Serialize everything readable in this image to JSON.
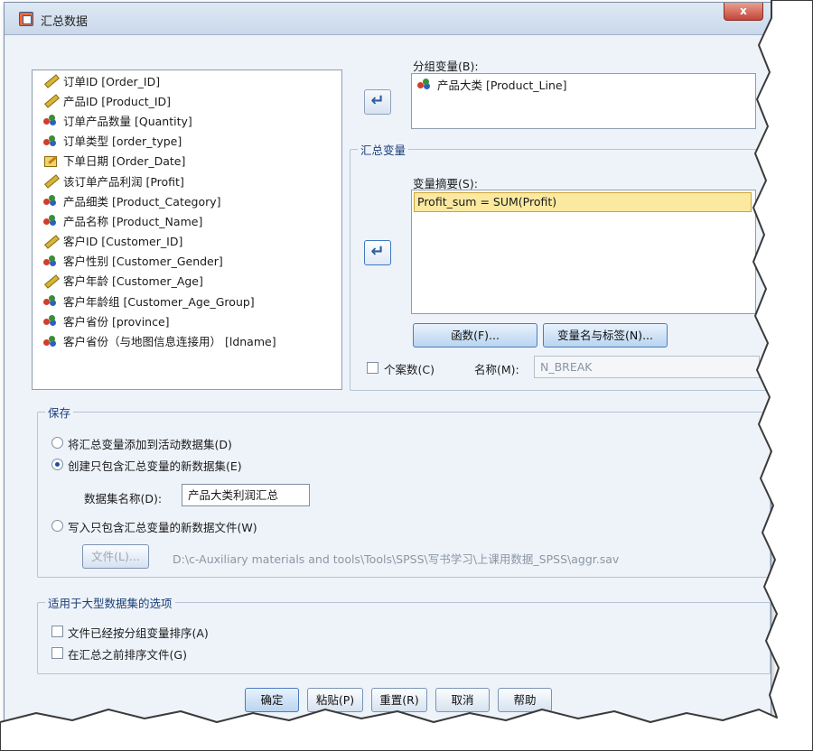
{
  "window": {
    "title": "汇总数据",
    "close_label": "x"
  },
  "source_variables": [
    {
      "icon": "ruler-icon",
      "label": "订单ID [Order_ID]"
    },
    {
      "icon": "ruler-icon",
      "label": "产品ID [Product_ID]"
    },
    {
      "icon": "nominal-icon",
      "label": "订单产品数量 [Quantity]"
    },
    {
      "icon": "nominal-icon",
      "label": "订单类型 [order_type]"
    },
    {
      "icon": "date-icon",
      "label": "下单日期 [Order_Date]"
    },
    {
      "icon": "ruler-icon",
      "label": "该订单产品利润 [Profit]"
    },
    {
      "icon": "nominal-icon",
      "label": "产品细类 [Product_Category]"
    },
    {
      "icon": "nominal-icon",
      "label": "产品名称 [Product_Name]"
    },
    {
      "icon": "ruler-icon",
      "label": "客户ID [Customer_ID]"
    },
    {
      "icon": "nominal-icon",
      "label": "客户性别 [Customer_Gender]"
    },
    {
      "icon": "ruler-icon",
      "label": "客户年龄 [Customer_Age]"
    },
    {
      "icon": "nominal-icon",
      "label": "客户年龄组 [Customer_Age_Group]"
    },
    {
      "icon": "nominal-icon",
      "label": "客户省份 [province]"
    },
    {
      "icon": "nominal-icon",
      "label": "客户省份（与地图信息连接用） [ldname]"
    }
  ],
  "break_variables": {
    "label": "分组变量",
    "hotkey": "(B):",
    "items": [
      {
        "icon": "nominal-icon",
        "label": "产品大类 [Product_Line]"
      }
    ]
  },
  "aggregated_variables": {
    "group_label": "汇总变量",
    "summary_label": "变量摘要",
    "summary_hotkey": "(S):",
    "items": [
      "Profit_sum = SUM(Profit)"
    ],
    "function_button": "函数(F)...",
    "name_label_button": "变量名与标签(N)...",
    "number_of_cases_label": "个案数(C)",
    "name_label": "名称(M):",
    "name_value": "N_BREAK"
  },
  "save": {
    "group_label": "保存",
    "option_add": "将汇总变量添加到活动数据集(D)",
    "option_new_dataset": "创建只包含汇总变量的新数据集(E)",
    "dataset_name_label": "数据集名称(D):",
    "dataset_name_value": "产品大类利润汇总",
    "option_write_file": "写入只包含汇总变量的新数据文件(W)",
    "file_button": "文件(L)...",
    "file_path": "D:\\c-Auxiliary materials and tools\\Tools\\SPSS\\写书学习\\上课用数据_SPSS\\aggr.sav"
  },
  "large_options": {
    "group_label": "适用于大型数据集的选项",
    "option_sorted": "文件已经按分组变量排序(A)",
    "option_sort_before": "在汇总之前排序文件(G)"
  },
  "footer": {
    "ok": "确定",
    "paste": "粘贴(P)",
    "reset": "重置(R)",
    "cancel": "取消",
    "help": "帮助"
  }
}
